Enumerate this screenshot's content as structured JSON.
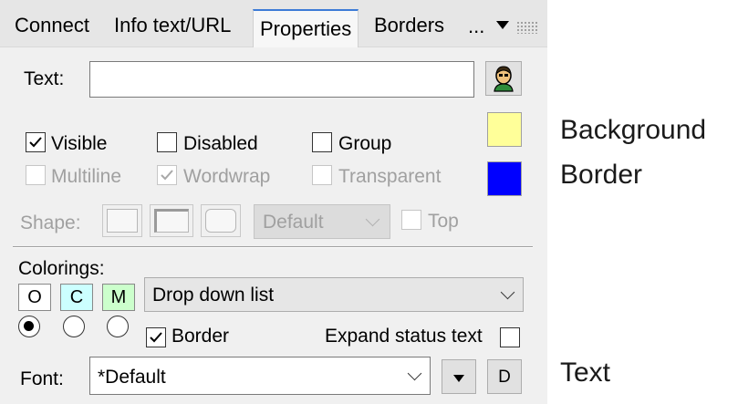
{
  "tabs": {
    "connect": "Connect",
    "info": "Info text/URL",
    "properties": "Properties",
    "borders": "Borders",
    "more": "..."
  },
  "text_row": {
    "label": "Text:",
    "value": ""
  },
  "options": {
    "visible": {
      "label": "Visible",
      "checked": true
    },
    "disabled": {
      "label": "Disabled",
      "checked": false
    },
    "group": {
      "label": "Group",
      "checked": false
    },
    "multiline": {
      "label": "Multiline",
      "checked": false
    },
    "wordwrap": {
      "label": "Wordwrap",
      "checked": true
    },
    "transparent": {
      "label": "Transparent",
      "checked": false
    }
  },
  "shape": {
    "label": "Shape:",
    "combo_value": "Default",
    "top_label": "Top"
  },
  "colorings": {
    "label": "Colorings:",
    "o": "O",
    "c": "C",
    "m": "M",
    "dropdown_value": "Drop down list",
    "selected_radio": 0
  },
  "border_check": {
    "label": "Border",
    "checked": true
  },
  "expand_status": {
    "label": "Expand status text",
    "checked": false
  },
  "font": {
    "label": "Font:",
    "value": "*Default",
    "d_button": "D"
  },
  "swatches": {
    "background": "#ffff99",
    "border": "#0000ff"
  },
  "side_labels": {
    "background": "Background",
    "border": "Border",
    "text": "Text"
  },
  "colors": {
    "c_bg": "#ccffff",
    "m_bg": "#ccffcc",
    "accent": "#3c7bd7"
  }
}
